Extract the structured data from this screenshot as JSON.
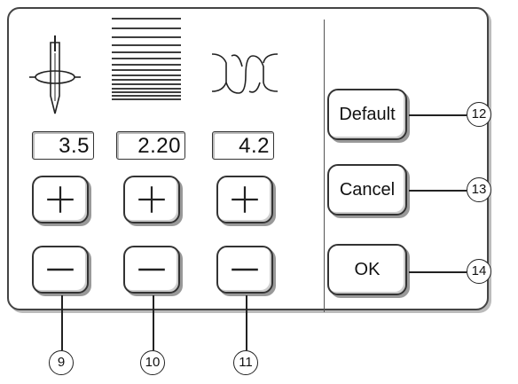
{
  "values": {
    "stitch_width": "3.5",
    "stitch_length": "2.20",
    "tension": "4.2"
  },
  "buttons": {
    "default_label": "Default",
    "cancel_label": "Cancel",
    "ok_label": "OK"
  },
  "callouts": {
    "c9": "9",
    "c10": "10",
    "c11": "11",
    "c12": "12",
    "c13": "13",
    "c14": "14"
  },
  "icons": {
    "col1": "needle-position-icon",
    "col2": "stitch-length-icon",
    "col3": "thread-tension-icon",
    "plus": "plus-icon",
    "minus": "minus-icon"
  }
}
